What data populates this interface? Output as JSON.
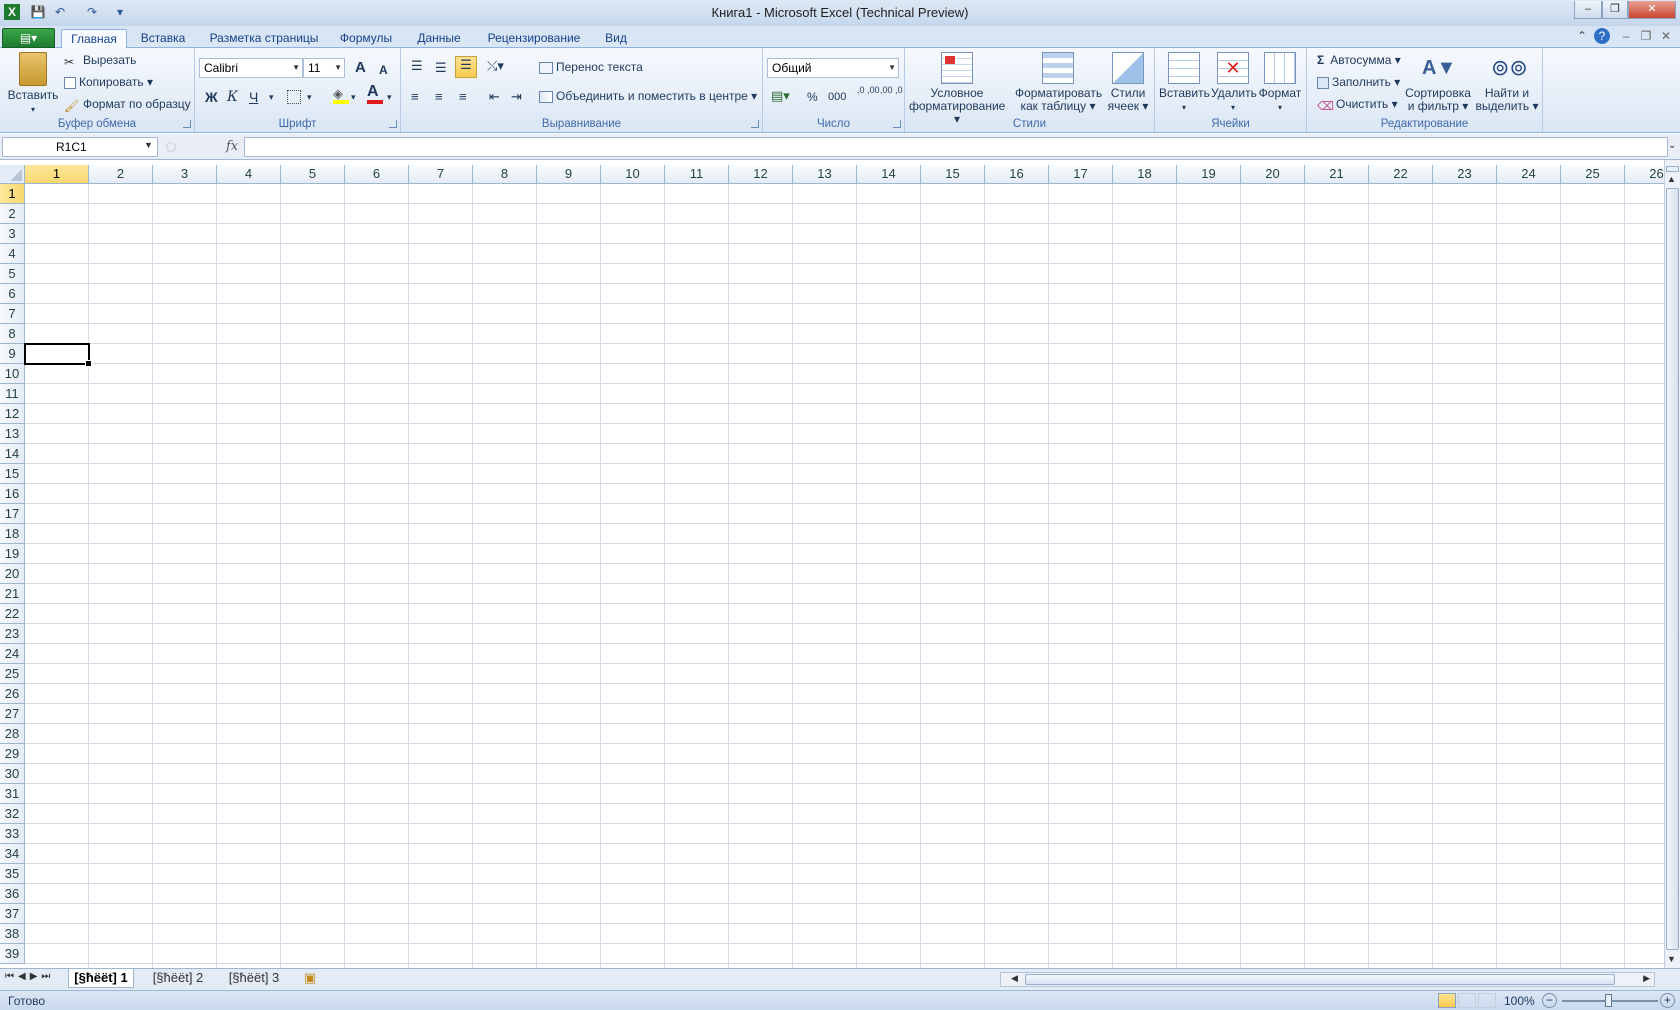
{
  "window": {
    "title": "Книга1  -  Microsoft Excel (Technical Preview)"
  },
  "qat": {
    "save": "💾",
    "undo": "↶",
    "redo": "↷",
    "more": "▾"
  },
  "controls": {
    "minimize": "–",
    "restore": "❐",
    "close": "✕"
  },
  "tabs": {
    "file": "▤▾",
    "items": [
      "Главная",
      "Вставка",
      "Разметка страницы",
      "Формулы",
      "Данные",
      "Рецензирование",
      "Вид"
    ],
    "active": "Главная"
  },
  "clipboard": {
    "label": "Буфер обмена",
    "paste": "Вставить",
    "cut": "Вырезать",
    "copy": "Копировать",
    "format_painter": "Формат по образцу"
  },
  "font": {
    "label": "Шрифт",
    "name": "Calibri",
    "size": "11",
    "bold": "Ж",
    "italic": "К",
    "underline": "Ч",
    "grow": "A",
    "shrink": "A"
  },
  "alignment": {
    "label": "Выравнивание",
    "wrap": "Перенос текста",
    "merge": "Объединить и поместить в центре"
  },
  "number": {
    "label": "Число",
    "format": "Общий",
    "percent": "%",
    "thousands": "000",
    "inc_dec": ",0 ,00",
    "dec_dec": ",00 ,0"
  },
  "styles": {
    "label": "Стили",
    "conditional": "Условное форматирование",
    "as_table": "Форматировать как таблицу",
    "cell_styles": "Стили ячеек"
  },
  "cells_grp": {
    "label": "Ячейки",
    "insert": "Вставить",
    "delete": "Удалить",
    "format": "Формат"
  },
  "editing": {
    "label": "Редактирование",
    "autosum": "Автосумма",
    "fill": "Заполнить",
    "clear": "Очистить",
    "sort": "Сортировка и фильтр",
    "find": "Найти и выделить",
    "sigma": "Σ"
  },
  "formula_bar": {
    "name_box": "R1C1",
    "fx": "fx",
    "value": ""
  },
  "sheet": {
    "columns": [
      "1",
      "2",
      "3",
      "4",
      "5",
      "6",
      "7",
      "8",
      "9",
      "10",
      "11",
      "12",
      "13",
      "14",
      "15",
      "16",
      "17",
      "18",
      "19",
      "20",
      "21",
      "22",
      "23",
      "24",
      "25",
      "26"
    ],
    "rows": [
      "1",
      "2",
      "3",
      "4",
      "5",
      "6",
      "7",
      "8",
      "9",
      "10",
      "11",
      "12",
      "13",
      "14",
      "15",
      "16",
      "17",
      "18",
      "19",
      "20",
      "21",
      "22",
      "23",
      "24",
      "25",
      "26",
      "27",
      "28",
      "29",
      "30",
      "31",
      "32",
      "33",
      "34",
      "35",
      "36",
      "37",
      "38",
      "39"
    ],
    "selected_col": "1",
    "selected_row": "1"
  },
  "sheet_tabs": {
    "items": [
      "[§ħëët] 1",
      "[§ħëët] 2",
      "[§ħëët] 3"
    ],
    "active": 0
  },
  "status": {
    "ready": "Готово",
    "zoom": "100%"
  },
  "colors": {
    "accent": "#1e7a2d",
    "selection": "#f9d870"
  }
}
